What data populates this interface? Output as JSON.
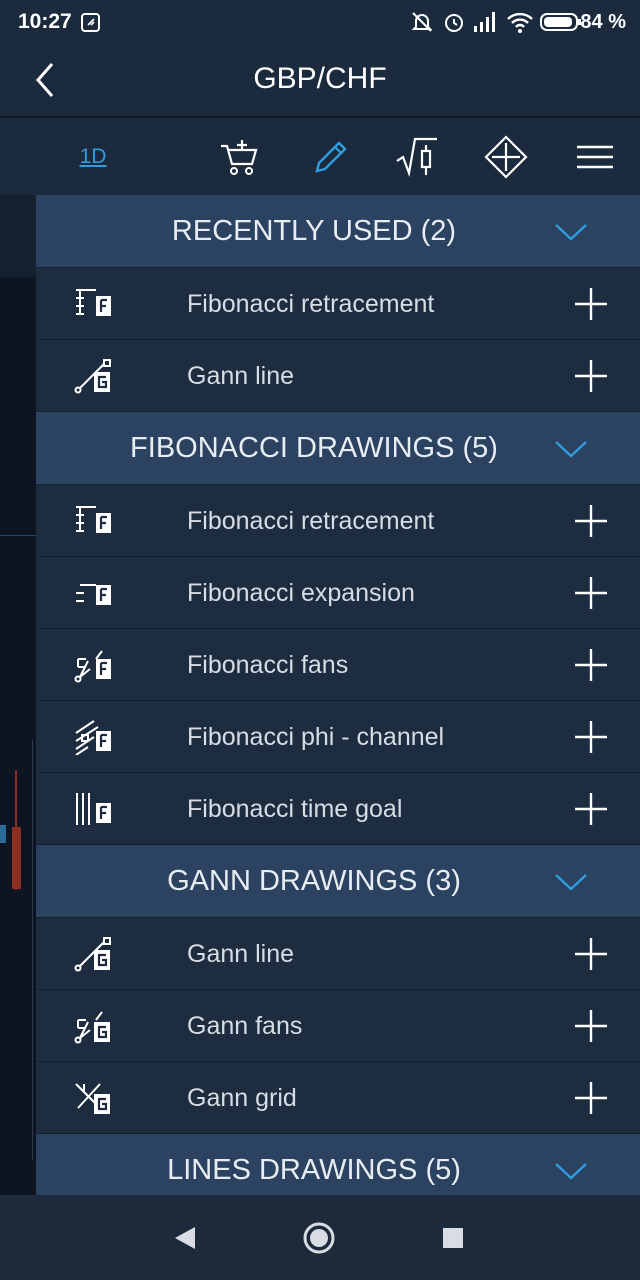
{
  "status_bar": {
    "time": "10:27",
    "battery": "84 %"
  },
  "header": {
    "title": "GBP/CHF",
    "back_icon": "chevron-left-icon"
  },
  "toolbar": {
    "timeframe": "1D",
    "icons": [
      "add-to-cart-icon",
      "pencil-icon",
      "indicator-icon",
      "move-icon",
      "menu-icon"
    ],
    "active_color": "#2f9de0"
  },
  "sections": [
    {
      "title": "RECENTLY USED (2)",
      "items": [
        {
          "label": "Fibonacci retracement",
          "icon": "fib-retracement-icon"
        },
        {
          "label": "Gann line",
          "icon": "gann-line-icon"
        }
      ]
    },
    {
      "title": "FIBONACCI DRAWINGS (5)",
      "items": [
        {
          "label": "Fibonacci retracement",
          "icon": "fib-retracement-icon"
        },
        {
          "label": "Fibonacci expansion",
          "icon": "fib-expansion-icon"
        },
        {
          "label": "Fibonacci fans",
          "icon": "fib-fans-icon"
        },
        {
          "label": "Fibonacci phi - channel",
          "icon": "fib-phi-channel-icon"
        },
        {
          "label": "Fibonacci time goal",
          "icon": "fib-time-goal-icon"
        }
      ]
    },
    {
      "title": "GANN DRAWINGS (3)",
      "items": [
        {
          "label": "Gann line",
          "icon": "gann-line-icon"
        },
        {
          "label": "Gann fans",
          "icon": "gann-fans-icon"
        },
        {
          "label": "Gann grid",
          "icon": "gann-grid-icon"
        }
      ]
    },
    {
      "title": "LINES DRAWINGS (5)",
      "items": []
    }
  ],
  "colors": {
    "header_bg": "#1b2a3d",
    "section_bg": "#2b4261",
    "item_bg": "#1e2c40",
    "accent": "#2f9de0"
  }
}
